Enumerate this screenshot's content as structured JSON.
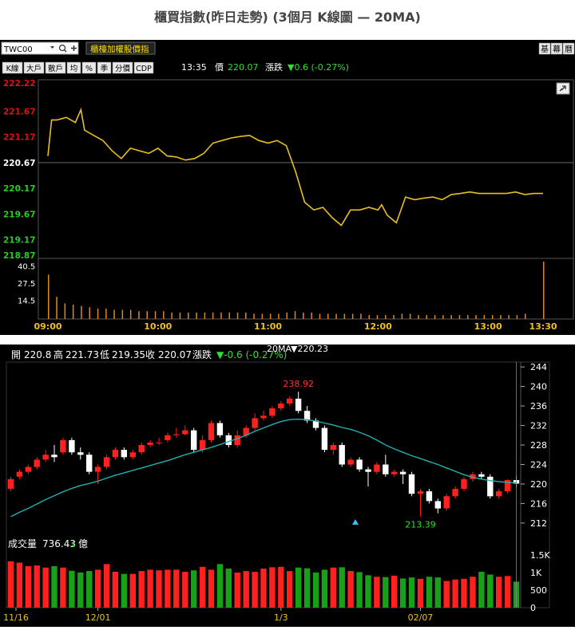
{
  "title": "櫃買指數(昨日走勢) (3個月 K線圖 — 20MA)",
  "colors": {
    "up": "#ff2020",
    "down": "#18a018",
    "line": "#e8c020",
    "ma": "#20b0b0",
    "price_up": "#e01010",
    "price_down": "#20d020",
    "grid": "#444444",
    "axis_text": "#ffffff"
  },
  "intraday": {
    "symbol": "TWC00",
    "dropdown_icon": "caret-down-icon",
    "search_icon": "search-icon",
    "add_icon": "plus-icon",
    "linked_label": "櫃檯加權股價指",
    "tool_buttons": [
      "K線",
      "大戶",
      "散戶",
      "均",
      "%",
      "季",
      "分價",
      "CDP"
    ],
    "right_buttons": [
      "基",
      "幕",
      "曆"
    ],
    "time": "13:35",
    "price_label": "價",
    "price": "220.07",
    "change_label": "漲跌",
    "change": "▼0.6 (-0.27%)",
    "link_icon": "link-icon",
    "y_ticks": [
      "222.22",
      "221.67",
      "221.17",
      "220.67",
      "220.17",
      "219.67",
      "219.17",
      "218.87"
    ],
    "y_tick_values": [
      222.22,
      221.67,
      221.17,
      220.67,
      220.17,
      219.67,
      219.17,
      218.87
    ],
    "ref_price": 220.67,
    "ylim": [
      218.87,
      222.22
    ],
    "vol_ticks": [
      "40.5",
      "27.5",
      "14.5"
    ],
    "vol_tick_values": [
      40.5,
      27.5,
      14.5
    ],
    "vol_max": 44,
    "x_ticks": [
      "09:00",
      "10:00",
      "11:00",
      "12:00",
      "13:00",
      "13:30"
    ],
    "x_tick_minutes": [
      0,
      60,
      120,
      180,
      240,
      270
    ],
    "total_minutes": 270
  },
  "chart_data": [
    {
      "type": "line",
      "title": "櫃買指數",
      "x_unit": "minutes since 09:00",
      "x": [
        0,
        2,
        5,
        10,
        15,
        18,
        20,
        25,
        30,
        35,
        40,
        45,
        50,
        55,
        60,
        65,
        70,
        75,
        80,
        85,
        90,
        95,
        100,
        105,
        110,
        115,
        120,
        125,
        130,
        135,
        140,
        145,
        150,
        155,
        160,
        165,
        170,
        175,
        180,
        182,
        185,
        190,
        195,
        200,
        205,
        210,
        215,
        220,
        225,
        230,
        235,
        240,
        243,
        246,
        250,
        255,
        260,
        265,
        270
      ],
      "y": [
        220.8,
        221.5,
        221.5,
        221.55,
        221.45,
        221.7,
        221.3,
        221.2,
        221.1,
        220.9,
        220.75,
        220.95,
        220.9,
        220.85,
        220.95,
        220.8,
        220.78,
        220.72,
        220.75,
        220.85,
        221.05,
        221.1,
        221.15,
        221.18,
        221.2,
        221.1,
        221.05,
        221.1,
        221.0,
        220.5,
        219.9,
        219.75,
        219.8,
        219.6,
        219.45,
        219.75,
        219.75,
        219.8,
        219.75,
        219.85,
        219.65,
        219.5,
        220.0,
        219.95,
        219.98,
        220.0,
        219.95,
        220.05,
        220.07,
        220.1,
        220.07,
        220.07,
        220.07,
        220.07,
        220.07,
        220.1,
        220.05,
        220.07,
        220.07
      ],
      "ylim": [
        218.87,
        222.22
      ],
      "volume": [
        34,
        17,
        12,
        11,
        10,
        9,
        8,
        8,
        7,
        7,
        7,
        6,
        6,
        6,
        6,
        5,
        5,
        5,
        5,
        5,
        5,
        5,
        5,
        5,
        5,
        4,
        4,
        4,
        4,
        5,
        6,
        5,
        5,
        4,
        4,
        4,
        4,
        4,
        4,
        3,
        3,
        3,
        3,
        4,
        4,
        3,
        3,
        3,
        3,
        3,
        3,
        3,
        3,
        3,
        3,
        3,
        3,
        3,
        4,
        44
      ],
      "volume_ticks": [
        40.5,
        27.5,
        14.5
      ]
    },
    {
      "type": "candlestick",
      "summary": {
        "open_label": "開",
        "open": "220.8",
        "high_label": "高",
        "high": "221.73",
        "low_label": "低",
        "low": "219.35",
        "close_label": "收",
        "close": "220.07",
        "change_label": "漲跌",
        "change": "▼-0.6 (-0.27%)",
        "ma_label": "20MA",
        "ma_value": "▼220.23"
      },
      "annotations": {
        "max": "238.92",
        "min": "213.39"
      },
      "x_ticks": [
        "11/16",
        "12/01",
        "1/3",
        "02/07"
      ],
      "x_tick_index": [
        0,
        10,
        31,
        47
      ],
      "y_ticks": [
        "244",
        "240",
        "236",
        "232",
        "228",
        "224",
        "220",
        "216",
        "212"
      ],
      "y_tick_values": [
        244,
        240,
        236,
        232,
        228,
        224,
        220,
        216,
        212
      ],
      "ylim": [
        211,
        245
      ],
      "candles": [
        [
          219.0,
          221.0,
          218.5,
          221.5
        ],
        [
          221.5,
          222.5,
          221.0,
          223.0
        ],
        [
          222.5,
          223.5,
          222.0,
          224.0
        ],
        [
          223.5,
          225.0,
          223.0,
          225.5
        ],
        [
          225.0,
          226.0,
          224.5,
          227.0
        ],
        [
          226.0,
          225.5,
          224.5,
          228.0
        ],
        [
          226.5,
          229.0,
          226.0,
          229.5
        ],
        [
          229.0,
          226.5,
          226.0,
          229.5
        ],
        [
          226.5,
          226.0,
          225.0,
          227.5
        ],
        [
          226.0,
          222.5,
          222.0,
          226.5
        ],
        [
          222.5,
          223.5,
          220.0,
          224.0
        ],
        [
          223.5,
          225.5,
          223.0,
          226.0
        ],
        [
          225.5,
          227.0,
          225.0,
          227.5
        ],
        [
          227.0,
          225.5,
          225.0,
          227.5
        ],
        [
          225.5,
          226.5,
          225.0,
          227.0
        ],
        [
          226.5,
          228.0,
          226.0,
          228.5
        ],
        [
          228.0,
          228.5,
          227.5,
          229.0
        ],
        [
          228.5,
          228.5,
          228.0,
          229.5
        ],
        [
          229.0,
          230.0,
          228.5,
          230.5
        ],
        [
          230.0,
          230.2,
          229.5,
          231.5
        ],
        [
          230.2,
          231.0,
          230.0,
          232.0
        ],
        [
          231.0,
          227.0,
          226.5,
          231.5
        ],
        [
          227.0,
          229.0,
          226.5,
          230.0
        ],
        [
          229.0,
          232.5,
          228.5,
          233.0
        ],
        [
          232.5,
          230.0,
          229.5,
          233.0
        ],
        [
          230.0,
          228.0,
          227.5,
          230.5
        ],
        [
          228.0,
          230.0,
          227.5,
          231.0
        ],
        [
          230.0,
          231.5,
          229.5,
          232.0
        ],
        [
          231.5,
          233.5,
          231.0,
          234.5
        ],
        [
          233.5,
          234.0,
          233.0,
          235.0
        ],
        [
          234.0,
          235.5,
          233.5,
          236.0
        ],
        [
          235.5,
          236.5,
          235.0,
          237.0
        ],
        [
          236.5,
          237.5,
          236.0,
          238.0
        ],
        [
          237.5,
          235.0,
          234.5,
          238.92
        ],
        [
          235.0,
          233.0,
          232.5,
          236.0
        ],
        [
          233.0,
          231.5,
          231.0,
          233.5
        ],
        [
          231.5,
          227.0,
          226.5,
          232.0
        ],
        [
          227.0,
          228.0,
          226.0,
          228.5
        ],
        [
          228.0,
          224.0,
          223.5,
          228.5
        ],
        [
          224.0,
          225.0,
          223.5,
          225.5
        ],
        [
          225.0,
          223.0,
          222.5,
          225.5
        ],
        [
          223.0,
          222.5,
          219.5,
          223.5
        ],
        [
          222.5,
          224.0,
          222.0,
          224.5
        ],
        [
          224.0,
          222.0,
          221.5,
          226.0
        ],
        [
          222.0,
          222.5,
          221.5,
          223.0
        ],
        [
          222.5,
          222.0,
          220.0,
          223.0
        ],
        [
          222.0,
          218.0,
          217.5,
          222.5
        ],
        [
          218.0,
          218.5,
          213.39,
          219.0
        ],
        [
          218.5,
          216.5,
          216.0,
          219.0
        ],
        [
          216.5,
          215.0,
          214.0,
          217.0
        ],
        [
          215.0,
          217.5,
          214.5,
          218.0
        ],
        [
          217.5,
          219.0,
          217.0,
          219.5
        ],
        [
          219.0,
          221.0,
          218.5,
          221.5
        ],
        [
          221.0,
          222.0,
          220.5,
          222.5
        ],
        [
          222.0,
          221.5,
          221.0,
          222.5
        ],
        [
          221.5,
          217.5,
          217.0,
          222.0
        ],
        [
          217.5,
          218.5,
          217.0,
          219.0
        ],
        [
          218.5,
          220.8,
          218.0,
          221.0
        ],
        [
          220.8,
          220.07,
          219.35,
          221.73
        ]
      ],
      "ma20": [
        213.3,
        214.2,
        215.0,
        215.9,
        216.8,
        217.6,
        218.4,
        219.1,
        219.7,
        220.1,
        220.6,
        221.2,
        221.8,
        222.3,
        222.8,
        223.3,
        223.8,
        224.3,
        224.8,
        225.4,
        226.0,
        226.5,
        227.0,
        227.5,
        228.1,
        228.7,
        229.3,
        230.0,
        230.8,
        231.5,
        232.2,
        232.8,
        233.2,
        233.3,
        233.2,
        232.9,
        232.5,
        232.1,
        231.6,
        231.2,
        230.6,
        229.9,
        229.0,
        228.0,
        227.2,
        226.5,
        225.8,
        225.2,
        224.6,
        224.0,
        223.3,
        222.6,
        221.9,
        221.4,
        221.0,
        220.7,
        220.5,
        220.35,
        220.23
      ],
      "volume_label": "成交量",
      "volume_value": "736.43",
      "volume_arrow": "↓",
      "volume_unit": "億",
      "volume_ticks": [
        "1.5K",
        "1K",
        "500",
        "0"
      ],
      "volume_tick_values": [
        1500,
        1000,
        500,
        0
      ],
      "volume_max": 1700,
      "volume": [
        1320,
        1280,
        1180,
        1200,
        1140,
        1180,
        1140,
        1050,
        1000,
        1040,
        1080,
        1240,
        1020,
        960,
        960,
        1040,
        1080,
        1060,
        1080,
        1080,
        1020,
        1060,
        1160,
        1080,
        1240,
        1110,
        1000,
        1040,
        1020,
        1110,
        1150,
        1160,
        1040,
        1140,
        1120,
        1000,
        1080,
        1140,
        1150,
        1040,
        1010,
        920,
        880,
        870,
        910,
        830,
        860,
        820,
        880,
        860,
        760,
        800,
        820,
        880,
        1020,
        940,
        880,
        900,
        740
      ]
    }
  ]
}
